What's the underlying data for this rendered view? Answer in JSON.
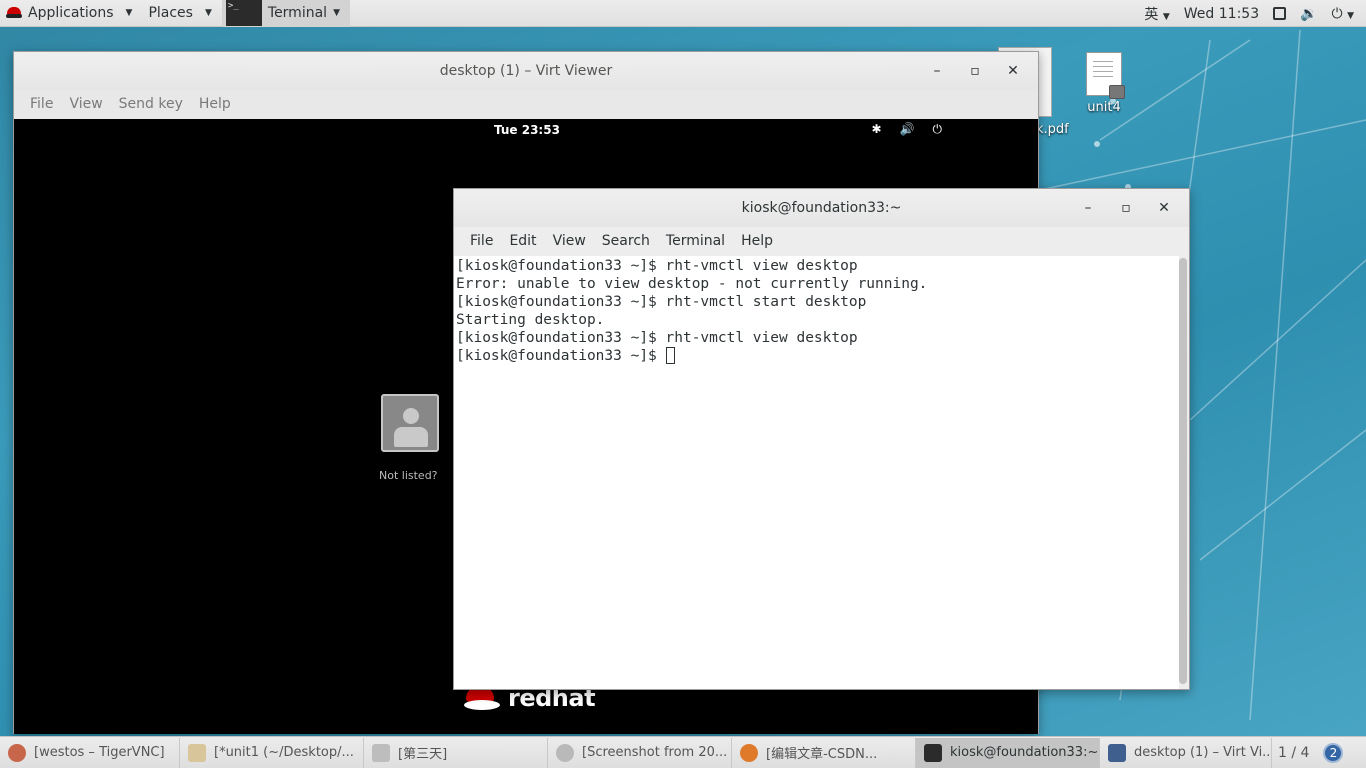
{
  "top_bar": {
    "applications": "Applications",
    "places": "Places",
    "terminal": "Terminal",
    "input_method": "英",
    "clock": "Wed 11:53"
  },
  "desktop": {
    "icons": [
      {
        "label": "unit4"
      },
      {
        "label": "k.pdf"
      }
    ]
  },
  "virt_viewer": {
    "title": "desktop (1) – Virt Viewer",
    "menu": [
      "File",
      "View",
      "Send key",
      "Help"
    ],
    "guest": {
      "clock": "Tue 23:53",
      "not_listed": "Not listed?",
      "logo_text": "redhat"
    }
  },
  "terminal": {
    "title": "kiosk@foundation33:~",
    "menu": [
      "File",
      "Edit",
      "View",
      "Search",
      "Terminal",
      "Help"
    ],
    "lines": [
      "[kiosk@foundation33 ~]$ rht-vmctl view desktop",
      "Error: unable to view desktop - not currently running.",
      "[kiosk@foundation33 ~]$ rht-vmctl start desktop",
      "Starting desktop.",
      "[kiosk@foundation33 ~]$ rht-vmctl view desktop",
      "[kiosk@foundation33 ~]$ "
    ]
  },
  "taskbar": {
    "tasks": [
      {
        "label": "[westos – TigerVNC]",
        "color": "#c7664a"
      },
      {
        "label": "[*unit1 (~/Desktop/...",
        "color": "#d8c59a"
      },
      {
        "label": "[第三天]",
        "color": "#bdbdbd"
      },
      {
        "label": "[Screenshot from 20...",
        "color": "#b9b9b9"
      },
      {
        "label": "[编辑文章-CSDN...",
        "color": "#e07a2b"
      },
      {
        "label": "kiosk@foundation33:~",
        "color": "#2b2b2b"
      },
      {
        "label": "desktop (1) – Virt Vi...",
        "color": "#3f5f8f"
      }
    ],
    "pager": "1 / 4",
    "workspace_badge": "2"
  }
}
